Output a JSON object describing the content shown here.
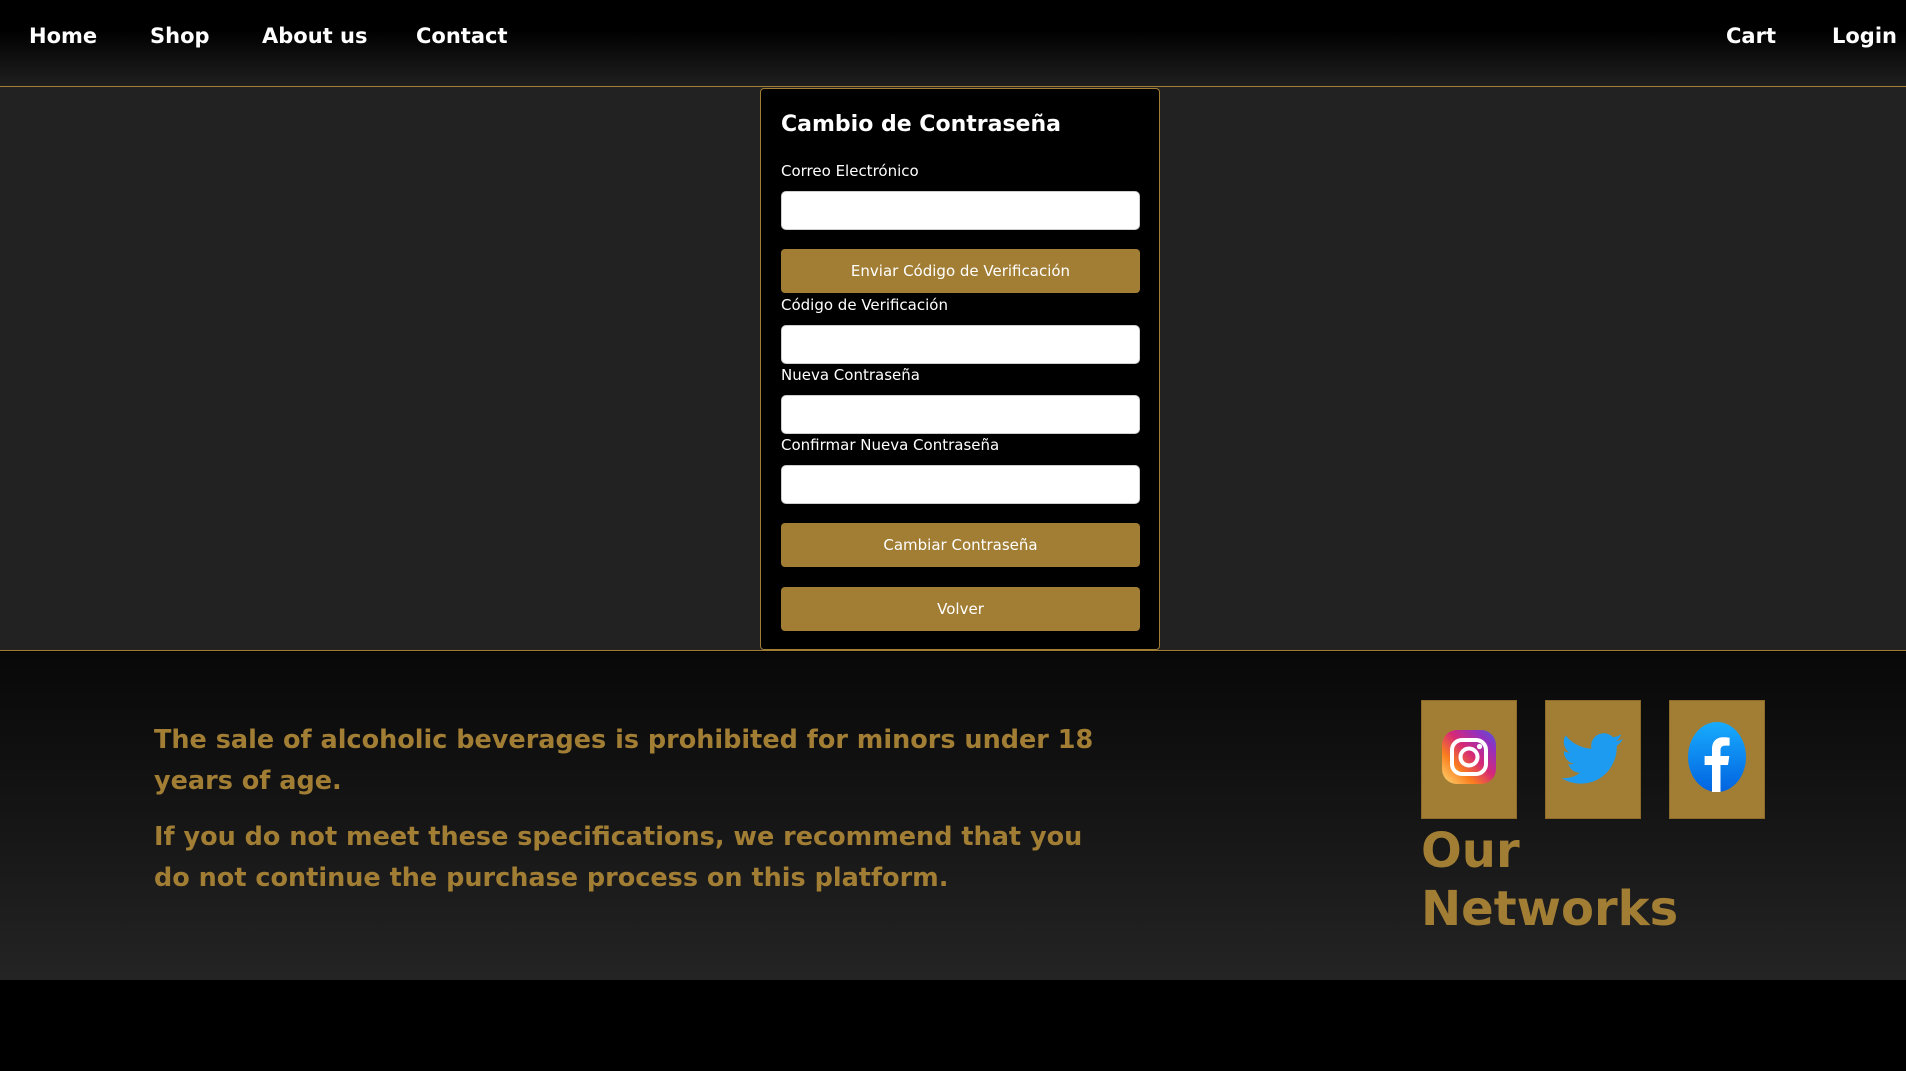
{
  "nav": {
    "home": "Home",
    "shop": "Shop",
    "about": "About us",
    "contact": "Contact",
    "cart": "Cart",
    "login": "Login"
  },
  "form": {
    "title": "Cambio de Contraseña",
    "email_label": "Correo Electrónico",
    "email_value": "",
    "send_code_button": "Enviar Código de Verificación",
    "code_label": "Código de Verificación",
    "code_value": "",
    "new_password_label": "Nueva Contraseña",
    "new_password_value": "",
    "confirm_password_label": "Confirmar Nueva Contraseña",
    "confirm_password_value": "",
    "change_button": "Cambiar Contraseña",
    "back_button": "Volver"
  },
  "footer": {
    "warning_1": "The sale of alcoholic beverages is prohibited for minors under 18 years of age.",
    "warning_2": "If you do not meet these specifications, we recommend that you do not continue the purchase process on this platform.",
    "networks_title": "Our Networks",
    "social_icons": [
      "instagram-icon",
      "twitter-icon",
      "facebook-icon"
    ]
  },
  "colors": {
    "accent": "#a27e35",
    "background": "#222222",
    "navbar": "#000000"
  }
}
